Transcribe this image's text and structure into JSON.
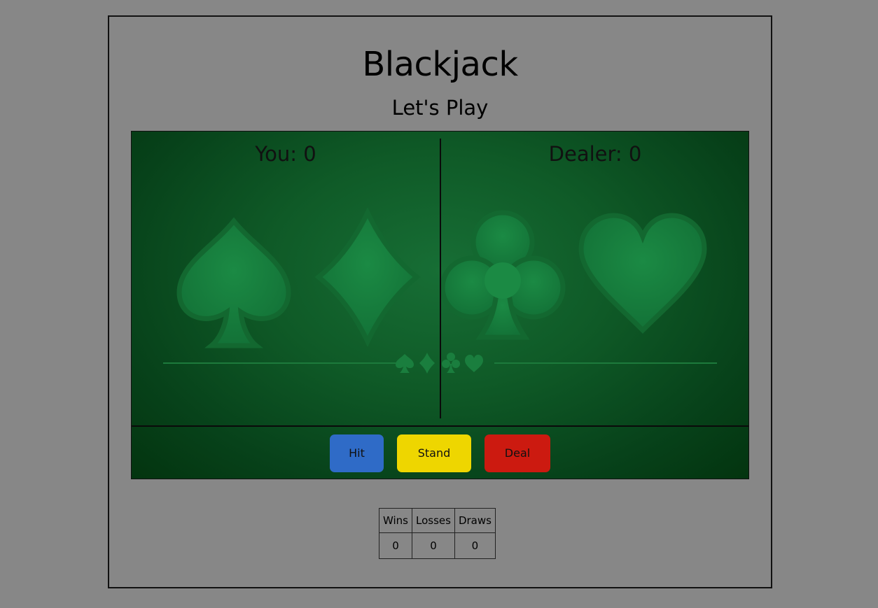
{
  "page": {
    "title": "Blackjack",
    "subtitle": "Let's Play"
  },
  "board": {
    "you_label": "You: 0",
    "dealer_label": "Dealer: 0",
    "felt_color": "#0f5a27",
    "suits": [
      "spade-icon",
      "diamond-icon",
      "club-icon",
      "heart-icon"
    ]
  },
  "controls": {
    "hit": {
      "label": "Hit",
      "color": "#2f6bc7"
    },
    "stand": {
      "label": "Stand",
      "color": "#eed600"
    },
    "deal": {
      "label": "Deal",
      "color": "#cc1a10"
    }
  },
  "stats": {
    "headers": [
      "Wins",
      "Losses",
      "Draws"
    ],
    "values": [
      "0",
      "0",
      "0"
    ]
  }
}
